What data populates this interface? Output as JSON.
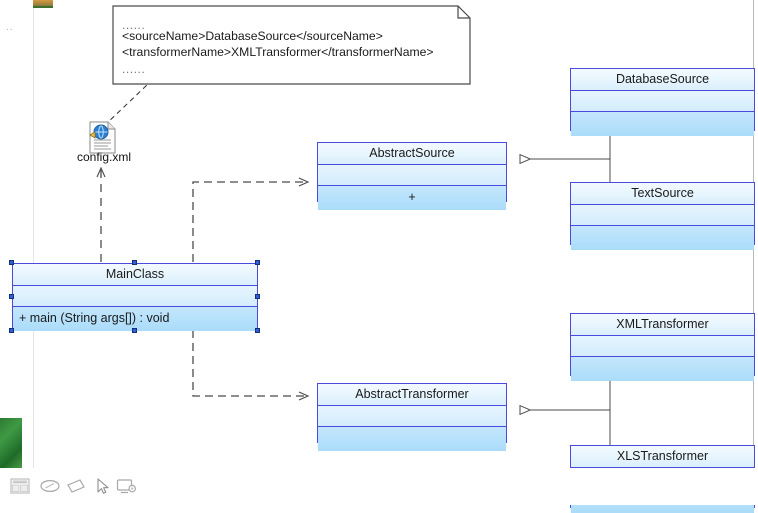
{
  "diagram": {
    "title": "UML class diagram",
    "note": {
      "name": "xml-config-note",
      "line_top_ellipsis": "......",
      "lines": [
        "<sourceName>DatabaseSource</sourceName>",
        "<transformerName>XMLTransformer</transformerName>"
      ],
      "line_bottom_ellipsis": "......"
    },
    "artifact": {
      "label": "config.xml",
      "icon": "xml-document-icon"
    },
    "classes": [
      {
        "id": "main-class",
        "name": "MainClass",
        "attributes": [],
        "operations": [
          "+ main (String args[])  : void"
        ],
        "selected": true
      },
      {
        "id": "abstract-source",
        "name": "AbstractSource",
        "attributes": [],
        "operations": [
          "+"
        ]
      },
      {
        "id": "database-source",
        "name": "DatabaseSource",
        "attributes": [],
        "operations": []
      },
      {
        "id": "text-source",
        "name": "TextSource",
        "attributes": [],
        "operations": []
      },
      {
        "id": "abstract-transformer",
        "name": "AbstractTransformer",
        "attributes": [],
        "operations": []
      },
      {
        "id": "xml-transformer",
        "name": "XMLTransformer",
        "attributes": [],
        "operations": []
      },
      {
        "id": "xls-transformer",
        "name": "XLSTransformer",
        "attributes": [],
        "operations": []
      }
    ],
    "relations": [
      {
        "kind": "generalization",
        "from": "DatabaseSource",
        "to": "AbstractSource"
      },
      {
        "kind": "generalization",
        "from": "TextSource",
        "to": "AbstractSource"
      },
      {
        "kind": "generalization",
        "from": "XMLTransformer",
        "to": "AbstractTransformer"
      },
      {
        "kind": "generalization",
        "from": "XLSTransformer",
        "to": "AbstractTransformer"
      },
      {
        "kind": "dependency",
        "from": "MainClass",
        "to": "AbstractSource"
      },
      {
        "kind": "dependency",
        "from": "MainClass",
        "to": "AbstractTransformer"
      },
      {
        "kind": "dependency",
        "from": "MainClass",
        "to": "config.xml"
      },
      {
        "kind": "anchor",
        "from": "config.xml",
        "to": "xml-config-note"
      }
    ]
  },
  "toolbar": {
    "items": [
      {
        "name": "form-grid-icon",
        "label": ""
      },
      {
        "name": "ellipse-icon",
        "label": ""
      },
      {
        "name": "diamond-icon",
        "label": ""
      },
      {
        "name": "pointer-cursor-icon",
        "label": ""
      },
      {
        "name": "screen-capture-icon",
        "label": ""
      }
    ]
  },
  "colors": {
    "class_border": "#4a4ae0",
    "class_fill_light": "#e6f5fe",
    "class_fill_dark": "#aadcfa",
    "connector": "#4b4b4b",
    "note_border": "#4a4a4a",
    "selection_handle": "#2f5fd0"
  }
}
